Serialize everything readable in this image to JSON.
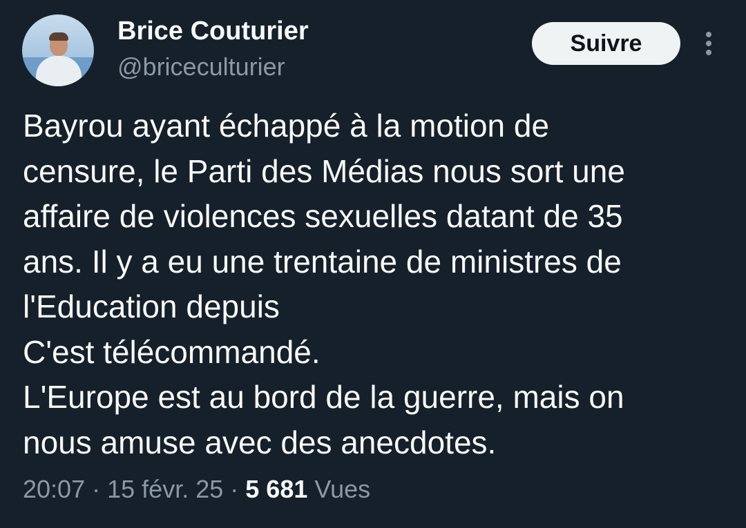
{
  "author": {
    "name": "Brice Couturier",
    "handle": "@briceculturier",
    "avatar_icon": "profile-photo"
  },
  "follow_button": {
    "label": "Suivre"
  },
  "more_menu": {
    "icon": "vertical-ellipsis-icon"
  },
  "tweet": {
    "lines": [
      "Bayrou ayant échappé à la motion de",
      "censure, le Parti des Médias nous sort une",
      "affaire de violences sexuelles datant de 35",
      "ans. Il y a eu une trentaine de ministres de",
      "l'Education depuis",
      "C'est télécommandé.",
      "L'Europe est au bord de la guerre, mais on",
      "nous amuse avec des anecdotes."
    ]
  },
  "meta": {
    "time": "20:07",
    "date": "15 févr. 25",
    "separator": "·",
    "views_count": "5 681",
    "views_label": "Vues"
  },
  "colors": {
    "background": "#15202b",
    "text_primary": "#f7f9f9",
    "text_secondary": "#8b98a5",
    "button_bg": "#eff3f4",
    "button_text": "#0f1419"
  }
}
